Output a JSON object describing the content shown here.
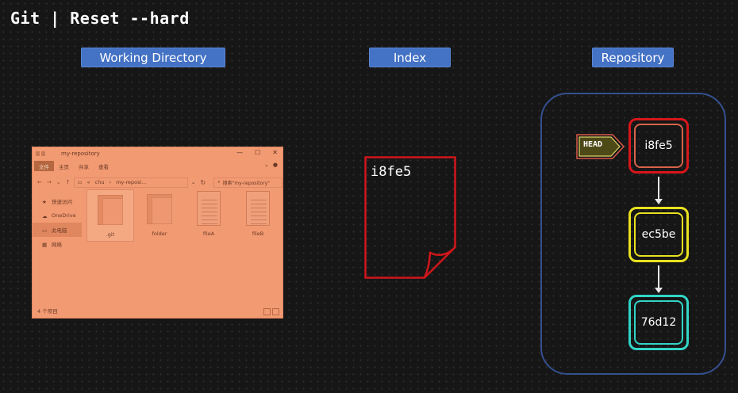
{
  "title": "Git | Reset --hard",
  "sections": {
    "working_directory": "Working Directory",
    "index": "Index",
    "repository": "Repository"
  },
  "explorer": {
    "window_title": "my-repository",
    "ribbon_tabs": [
      "文件",
      "主页",
      "共享",
      "查看"
    ],
    "address_parts": [
      "«",
      "chu",
      "›",
      "my-reposi..."
    ],
    "search_placeholder": "搜索\"my-repository\"",
    "nav_items": [
      "快速访问",
      "OneDrive",
      "此电脑",
      "网络"
    ],
    "files": [
      {
        "name": ".git",
        "icon": "folder-icon"
      },
      {
        "name": "folder",
        "icon": "folder-icon"
      },
      {
        "name": "fileA",
        "icon": "document-icon"
      },
      {
        "name": "fileB",
        "icon": "document-icon"
      }
    ],
    "status": "4 个项目",
    "tint_color": "#f29a72"
  },
  "index": {
    "commit": "i8fe5",
    "border_color": "#d0161b"
  },
  "repository": {
    "head_label": "HEAD",
    "commits": [
      {
        "id": "i8fe5",
        "color": "#d8161b"
      },
      {
        "id": "ec5be",
        "color": "#e9e11f"
      },
      {
        "id": "76d12",
        "color": "#32d5c7"
      }
    ],
    "border_color": "#34508f"
  }
}
